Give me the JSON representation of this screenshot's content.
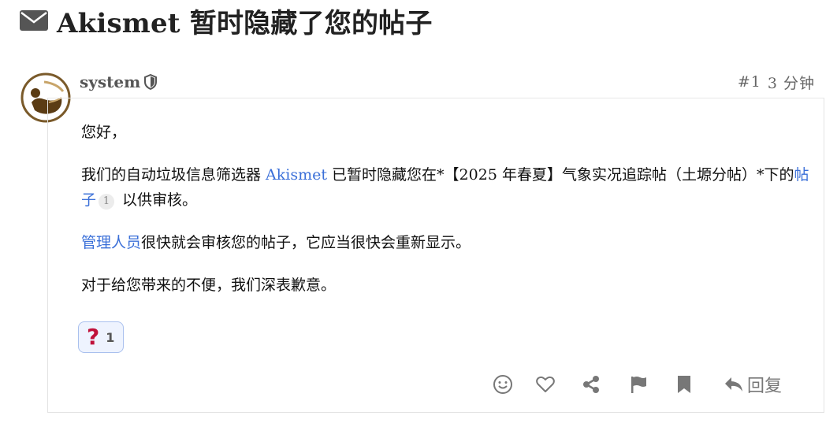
{
  "topic": {
    "title": "Akismet 暂时隐藏了您的帖子",
    "icon": "envelope-icon"
  },
  "post": {
    "username": "system",
    "user_badge_icon": "shield-icon",
    "post_number": "#1",
    "age": "3 分钟",
    "greeting": "您好，",
    "para1": {
      "before": "我们的自动垃圾信息筛选器 ",
      "akismet_link": "Akismet",
      "middle": " 已暂时隐藏您在*【2025 年春夏】气象实况追踪帖（土塬分帖）*下的",
      "post_link": "帖子",
      "post_link_count": "1",
      "after": " 以供审核。"
    },
    "para2": {
      "staff_link": "管理人员",
      "text": "很快就会审核您的帖子，它应当很快会重新显示。"
    },
    "para3": "对于给您带来的不便，我们深表歉意。"
  },
  "reaction": {
    "icon": "question-mark-icon",
    "emoji": "?",
    "count": "1",
    "color": "#c0113a"
  },
  "actions": {
    "items": [
      "smile-icon",
      "heart-icon",
      "share-icon",
      "flag-icon",
      "bookmark-icon"
    ],
    "reply_label": "回复"
  },
  "colors": {
    "link": "#3a6fd8",
    "avatar_ring": "#7a5a2a",
    "reaction_bg": "#eef3fe"
  }
}
